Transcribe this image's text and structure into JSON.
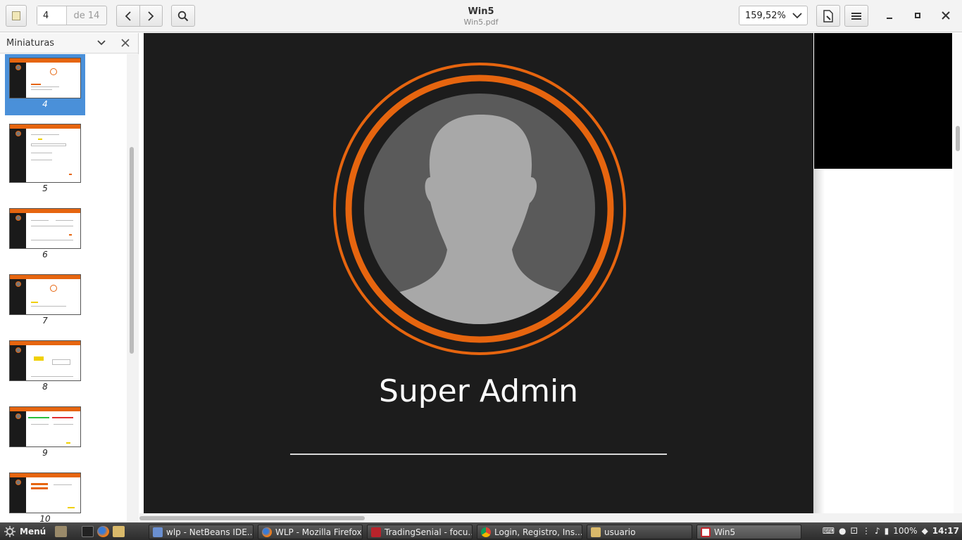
{
  "header": {
    "page_current": "4",
    "page_of": "de 14",
    "doc_title": "Win5",
    "doc_subtitle": "Win5.pdf",
    "zoom": "159,52%"
  },
  "sidebar": {
    "title": "Miniaturas",
    "thumbnails": [
      {
        "label": "4",
        "selected": true
      },
      {
        "label": "5"
      },
      {
        "label": "6"
      },
      {
        "label": "7"
      },
      {
        "label": "8"
      },
      {
        "label": "9"
      },
      {
        "label": "10"
      }
    ]
  },
  "slide": {
    "name": "Super Admin",
    "colors": {
      "background": "#1c1c1c",
      "ring": "#e6650f",
      "avatar_bg": "#5a5a5a",
      "silhouette": "#a8a8a8"
    }
  },
  "taskbar": {
    "menu_label": "Menú",
    "tasks": [
      {
        "label": "wlp - NetBeans IDE..."
      },
      {
        "label": "WLP - Mozilla Firefox"
      },
      {
        "label": "TradingSenial - focu..."
      },
      {
        "label": "Login, Registro, Ins..."
      },
      {
        "label": "usuario"
      },
      {
        "label": "Win5",
        "active": true
      }
    ],
    "battery": "100%",
    "clock": "14:17"
  }
}
